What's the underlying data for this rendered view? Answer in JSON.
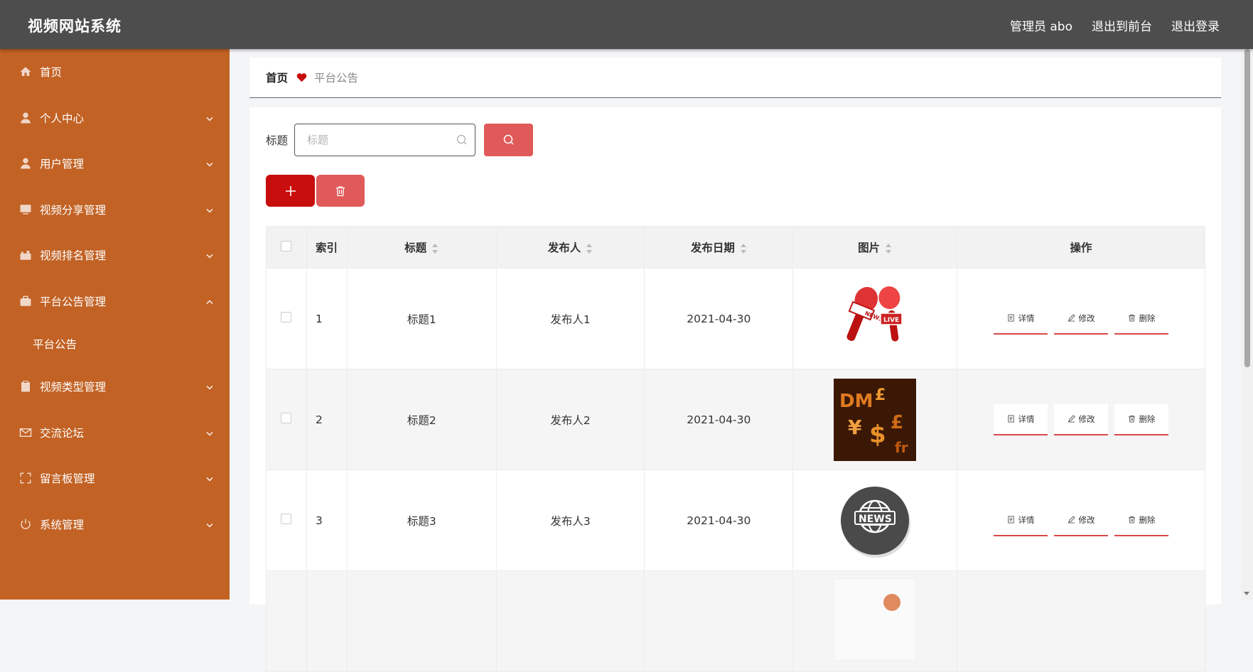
{
  "header": {
    "brand": "视频网站系统",
    "nav": [
      "管理员 abo",
      "退出到前台",
      "退出登录"
    ]
  },
  "sidebar": {
    "items": [
      {
        "label": "首页",
        "icon": "home-icon",
        "chevron": ""
      },
      {
        "label": "个人中心",
        "icon": "person-icon",
        "chevron": "down"
      },
      {
        "label": "用户管理",
        "icon": "person-icon",
        "chevron": "down"
      },
      {
        "label": "视频分享管理",
        "icon": "monitor-icon",
        "chevron": "down"
      },
      {
        "label": "视频排名管理",
        "icon": "camera-icon",
        "chevron": "down"
      },
      {
        "label": "平台公告管理",
        "icon": "briefcase-icon",
        "chevron": "up"
      },
      {
        "label": "视频类型管理",
        "icon": "clipboard-icon",
        "chevron": "down"
      },
      {
        "label": "交流论坛",
        "icon": "mail-icon",
        "chevron": "down"
      },
      {
        "label": "留言板管理",
        "icon": "fullscreen-icon",
        "chevron": "down"
      },
      {
        "label": "系统管理",
        "icon": "power-icon",
        "chevron": "down"
      }
    ],
    "submenu": [
      "平台公告"
    ]
  },
  "breadcrumb": {
    "home": "首页",
    "current": "平台公告"
  },
  "search": {
    "label": "标题",
    "placeholder": "标题"
  },
  "table": {
    "headers": [
      "索引",
      "标题",
      "发布人",
      "发布日期",
      "图片",
      "操作"
    ],
    "rows": [
      {
        "index": "1",
        "title": "标题1",
        "publisher": "发布人1",
        "date": "2021-04-30",
        "image": "news-microphones"
      },
      {
        "index": "2",
        "title": "标题2",
        "publisher": "发布人2",
        "date": "2021-04-30",
        "image": "currency-symbols"
      },
      {
        "index": "3",
        "title": "标题3",
        "publisher": "发布人3",
        "date": "2021-04-30",
        "image": "news-globe-badge"
      },
      {
        "index": "",
        "title": "",
        "publisher": "",
        "date": "",
        "image": "partial-image"
      }
    ],
    "actions": {
      "detail": "详情",
      "edit": "修改",
      "delete": "删除"
    }
  },
  "colors": {
    "topbar": "#4d4d4d",
    "sidebar": "#c26224",
    "primary_red": "#c80d0d",
    "light_red": "#e05a5a"
  }
}
